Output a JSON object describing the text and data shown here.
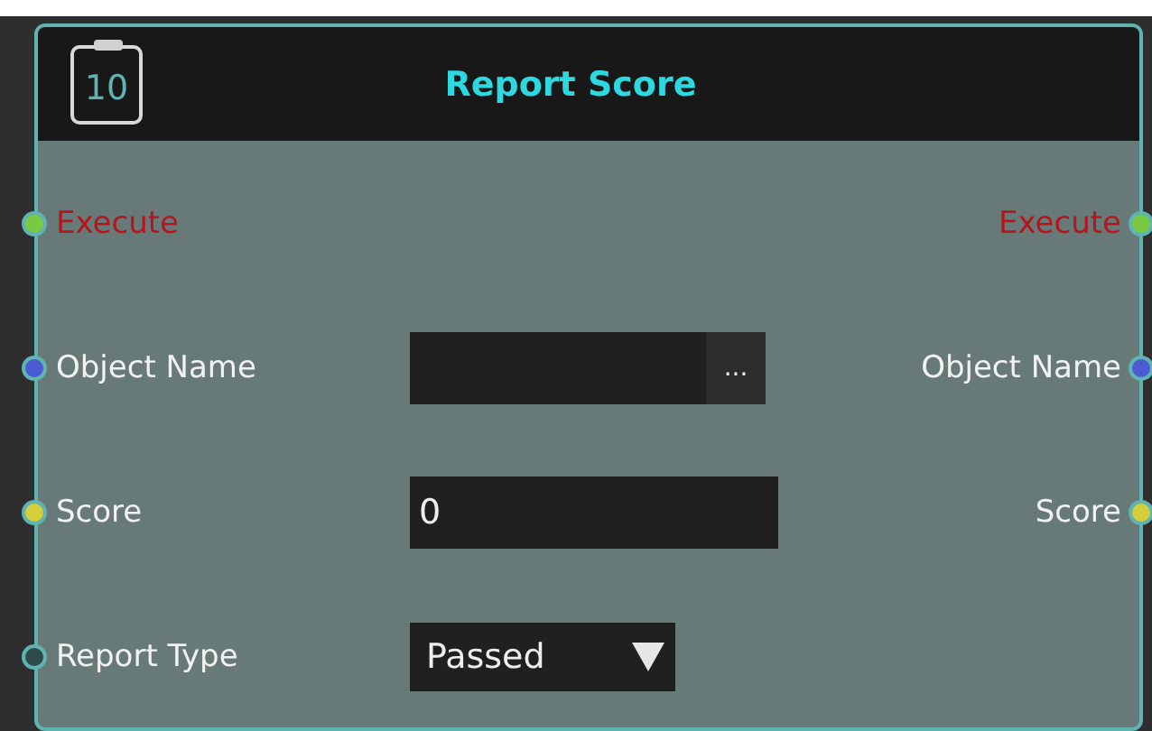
{
  "node": {
    "title": "Report Score",
    "icon_label": "10",
    "rows": [
      {
        "input": {
          "label": "Execute",
          "kind": "exec",
          "color": "#7ac943"
        },
        "output": {
          "label": "Execute",
          "kind": "exec",
          "color": "#7ac943"
        }
      },
      {
        "input": {
          "label": "Object Name",
          "kind": "data",
          "color": "#4a5bd4"
        },
        "field": {
          "kind": "browse",
          "button": "..."
        },
        "output": {
          "label": "Object Name",
          "kind": "data",
          "color": "#4a5bd4"
        }
      },
      {
        "input": {
          "label": "Score",
          "kind": "data",
          "color": "#d4cf3a"
        },
        "field": {
          "kind": "text",
          "value": "0"
        },
        "output": {
          "label": "Score",
          "kind": "data",
          "color": "#d4cf3a"
        }
      },
      {
        "input": {
          "label": "Report Type",
          "kind": "data",
          "color": "#2f4a4a"
        },
        "field": {
          "kind": "dropdown",
          "value": "Passed"
        }
      }
    ]
  }
}
